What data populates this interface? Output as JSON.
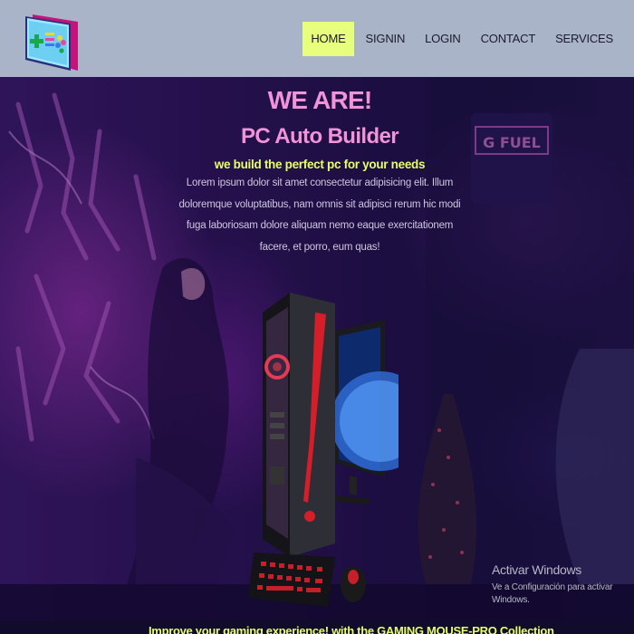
{
  "nav": {
    "items": [
      {
        "label": "HOME",
        "active": true
      },
      {
        "label": "SIGNIN",
        "active": false
      },
      {
        "label": "LOGIN",
        "active": false
      },
      {
        "label": "CONTACT",
        "active": false
      },
      {
        "label": "SERVICES",
        "active": false
      }
    ]
  },
  "hero": {
    "heading": "WE ARE!",
    "brand": "PC Auto Builder",
    "tagline": "we build the perfect pc for your needs",
    "body": "Lorem ipsum dolor sit amet consectetur adipisicing elit. Illum doloremque voluptatibus, nam omnis sit adipisci rerum hic modi fuga laboriosam dolore aliquam nemo eaque exercitationem facere, et porro, eum quas!",
    "sign_text": "G FUEL"
  },
  "watermark": {
    "title": "Activar Windows",
    "subtitle": "Ve a Configuración para activar Windows."
  },
  "bottom": {
    "text": "Improve your gaming experience! with the GAMING MOUSE-PRO Collection"
  },
  "colors": {
    "navbar_bg": "#a9b4c8",
    "nav_active_bg": "#e7ff7c",
    "heading_pink": "#f193d8",
    "tagline_yellow": "#e7ff6a",
    "hero_bg": "#2a1558"
  },
  "icons": {
    "logo": "gamepad-logo-icon"
  }
}
